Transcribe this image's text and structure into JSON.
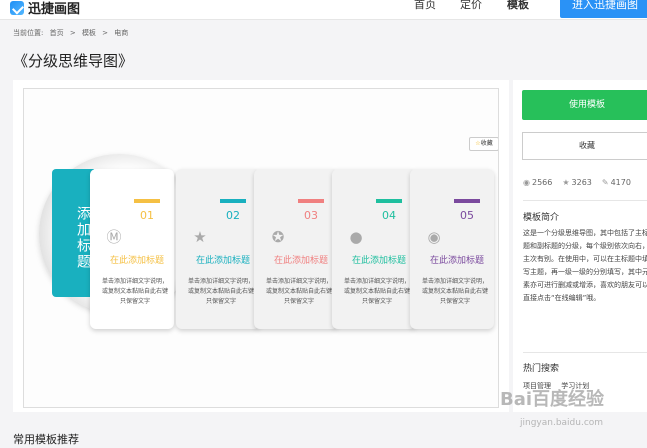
{
  "header": {
    "logo_text": "迅捷画图",
    "nav": [
      {
        "label": "首页"
      },
      {
        "label": "定价"
      },
      {
        "label": "模板"
      }
    ],
    "cta_label": "进入迅捷画图"
  },
  "breadcrumb": {
    "prefix": "当前位置:",
    "items": [
      "首页",
      ">",
      "模板",
      ">",
      "电商"
    ]
  },
  "page_title": "《分级思维导图》",
  "preview": {
    "favorite_label": "收藏",
    "main_topic": "添加标题",
    "cards": [
      {
        "num": "01",
        "head": "在此添加标题",
        "body": "单击添加详细文字说明，或复制文本黏贴自此右键只保留文字",
        "accent": "#f5c044",
        "icon": "mi-icon"
      },
      {
        "num": "02",
        "head": "在此添加标题",
        "body": "单击添加详细文字说明，或复制文本黏贴自此右键只保留文字",
        "accent": "#19b0bf",
        "icon": "star-icon"
      },
      {
        "num": "03",
        "head": "在此添加标题",
        "body": "单击添加详细文字说明，或复制文本黏贴自此右键只保留文字",
        "accent": "#f08080",
        "icon": "badge-icon"
      },
      {
        "num": "04",
        "head": "在此添加标题",
        "body": "单击添加详细文字说明，或复制文本黏贴自此右键只保留文字",
        "accent": "#1fbf9f",
        "icon": "wechat-icon"
      },
      {
        "num": "05",
        "head": "在此添加标题",
        "body": "单击添加详细文字说明，或复制文本黏贴自此右键只保留文字",
        "accent": "#7b4a9e",
        "icon": "weibo-icon"
      }
    ]
  },
  "sidebar": {
    "use_button": "使用模板",
    "favorite_button": "收藏",
    "stats": {
      "views": "2566",
      "likes": "3263",
      "edits": "4170"
    },
    "intro_title": "模板简介",
    "intro_text": "这是一个分级思维导图，其中包括了主标题和副标题的分级，每个级别依次向右，主次有别。在使用中，可以在主标题中填写主题，再一级一级的分别填写，其中元素亦可进行删减或增添，喜欢的朋友可以直接点击“在线编辑”哦。",
    "hot_title": "热门搜索",
    "hot_tags": [
      "项目管理",
      "学习计划"
    ]
  },
  "footer_title": "常用模板推荐",
  "watermark": {
    "main": "Bai百度经验",
    "sub": "jingyan.baidu.com"
  }
}
